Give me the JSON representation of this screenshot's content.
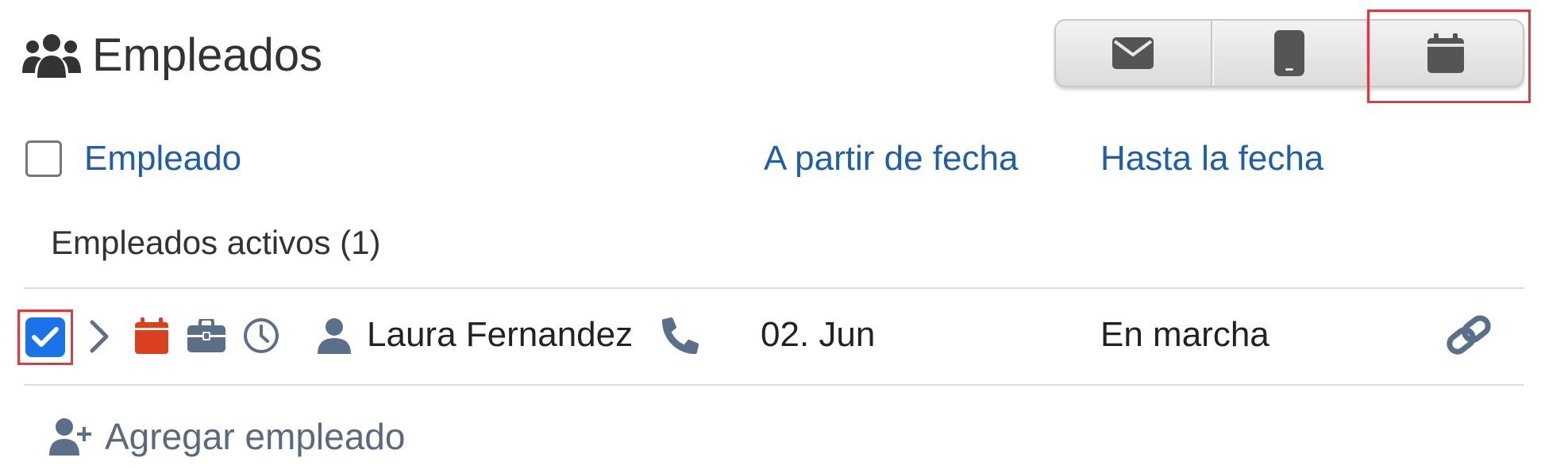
{
  "header": {
    "title": "Empleados",
    "icon": "users-icon"
  },
  "toolbar": {
    "buttons": [
      {
        "icon": "envelope-icon"
      },
      {
        "icon": "mobile-phone-icon"
      },
      {
        "icon": "calendar-icon",
        "highlighted": true
      }
    ]
  },
  "table": {
    "columns": [
      "Empleado",
      "A partir de fecha",
      "Hasta la fecha"
    ],
    "groups": [
      {
        "label": "Empleados activos (1)",
        "rows": [
          {
            "checked": true,
            "name": "Laura Fernandez",
            "from_date": "02. Jun",
            "to_date": "En marcha",
            "icons": [
              "chevron-right-icon",
              "calendar-icon",
              "briefcase-icon",
              "clock-icon",
              "user-icon",
              "phone-icon",
              "link-icon"
            ]
          }
        ]
      }
    ]
  },
  "footer": {
    "add_label": "Agregar empleado",
    "add_icon": "user-plus-icon"
  },
  "colors": {
    "link_blue": "#1f5ea8",
    "checkbox_blue": "#1a73e8",
    "calendar_red": "#d9401f",
    "icon_slate": "#5a6f8a",
    "highlight_red": "#e0393e"
  }
}
